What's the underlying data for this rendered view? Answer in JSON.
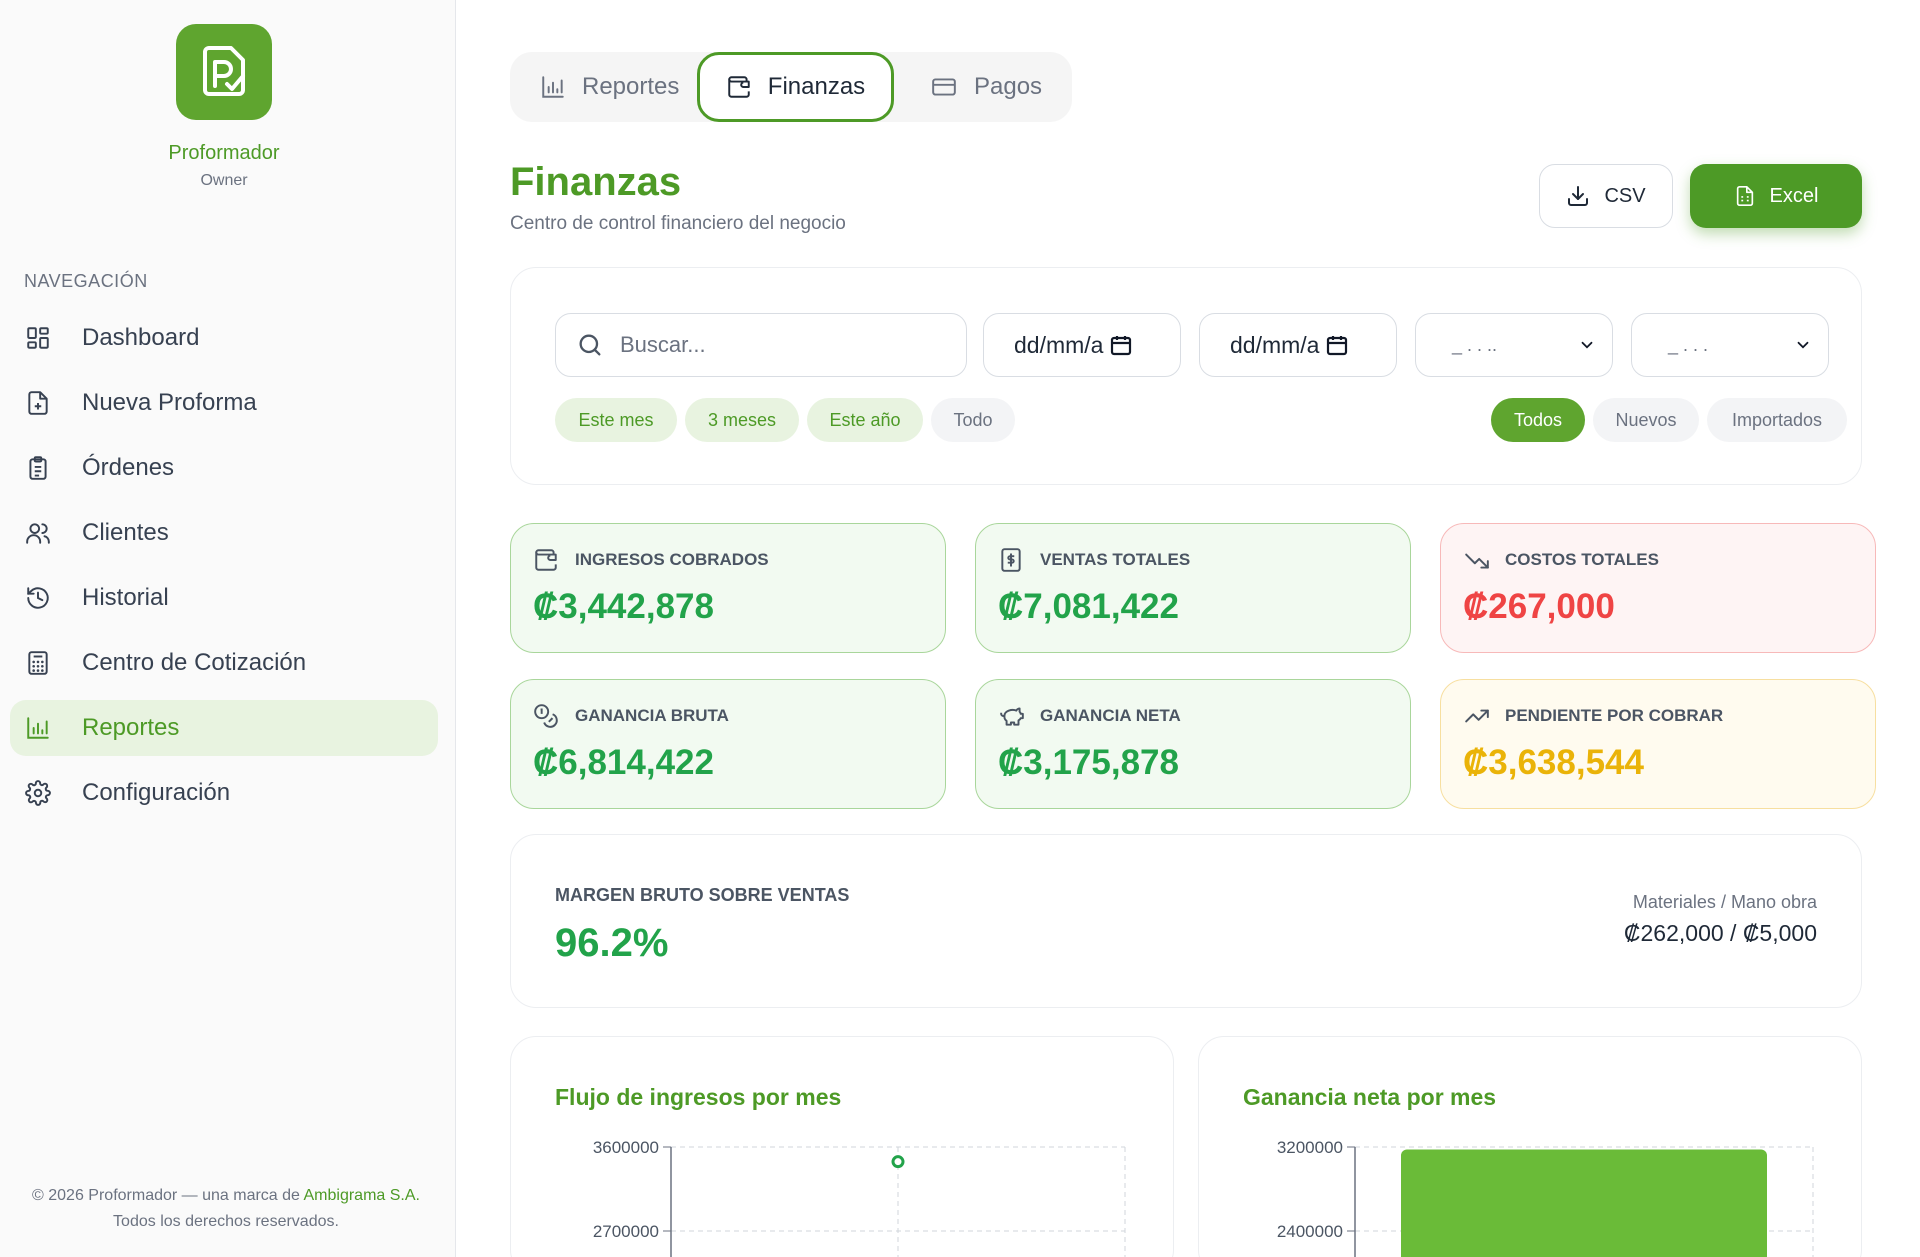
{
  "sidebar": {
    "brand": "Proformador",
    "role": "Owner",
    "nav_title": "NAVEGACIÓN",
    "items": [
      {
        "label": "Dashboard",
        "icon": "dashboard-icon"
      },
      {
        "label": "Nueva Proforma",
        "icon": "file-plus-icon"
      },
      {
        "label": "Órdenes",
        "icon": "clipboard-icon"
      },
      {
        "label": "Clientes",
        "icon": "users-icon"
      },
      {
        "label": "Historial",
        "icon": "history-icon"
      },
      {
        "label": "Centro de Cotización",
        "icon": "calculator-icon"
      },
      {
        "label": "Reportes",
        "icon": "bar-chart-icon",
        "active": true
      },
      {
        "label": "Configuración",
        "icon": "gear-icon"
      }
    ],
    "footer": {
      "prefix": "© 2026 Proformador — una marca de",
      "link": "Ambigrama S.A.",
      "suffix": "Todos los derechos reservados."
    }
  },
  "tabs": [
    {
      "label": "Reportes",
      "icon": "bar-chart-icon"
    },
    {
      "label": "Finanzas",
      "icon": "wallet-icon",
      "active": true
    },
    {
      "label": "Pagos",
      "icon": "credit-card-icon"
    }
  ],
  "header": {
    "title": "Finanzas",
    "subtitle": "Centro de control financiero del negocio",
    "csv_label": "CSV",
    "excel_label": "Excel"
  },
  "filters": {
    "search_placeholder": "Buscar...",
    "date_from": "dd/mm/a",
    "date_to": "dd/mm/a",
    "select1": "_ . . ..",
    "select2": "_ . . .",
    "period_chips": [
      "Este mes",
      "3 meses",
      "Este año",
      "Todo"
    ],
    "type_chips": [
      "Todos",
      "Nuevos",
      "Importados"
    ],
    "active_type": "Todos"
  },
  "kpis": [
    {
      "label": "INGRESOS COBRADOS",
      "value": "₡3,442,878",
      "icon": "wallet-icon",
      "tone": "green"
    },
    {
      "label": "VENTAS TOTALES",
      "value": "₡7,081,422",
      "icon": "dollar-receipt-icon",
      "tone": "green"
    },
    {
      "label": "COSTOS TOTALES",
      "value": "₡267,000",
      "icon": "trending-down-icon",
      "tone": "red"
    },
    {
      "label": "GANANCIA BRUTA",
      "value": "₡6,814,422",
      "icon": "coins-icon",
      "tone": "green"
    },
    {
      "label": "GANANCIA NETA",
      "value": "₡3,175,878",
      "icon": "piggy-bank-icon",
      "tone": "green"
    },
    {
      "label": "PENDIENTE POR COBRAR",
      "value": "₡3,638,544",
      "icon": "trending-up-icon",
      "tone": "yellow"
    }
  ],
  "margin": {
    "label": "MARGEN BRUTO SOBRE VENTAS",
    "value": "96.2%",
    "mat_label": "Materiales / Mano obra",
    "mat_value": "₡262,000 / ₡5,000"
  },
  "colors": {
    "primary": "#4d9a26",
    "accent": "#6abb38",
    "positive": "#22a34a",
    "negative": "#ef4444",
    "warning": "#eab308"
  },
  "chart_data": [
    {
      "type": "line",
      "title": "Flujo de ingresos por mes",
      "yticks": [
        "3600000",
        "2700000"
      ],
      "ylim": [
        2700000,
        3600000
      ],
      "series": [
        {
          "values": [
            3442878
          ]
        }
      ],
      "grid": true
    },
    {
      "type": "bar",
      "title": "Ganancia neta por mes",
      "yticks": [
        "3200000",
        "2400000"
      ],
      "ylim": [
        2400000,
        3200000
      ],
      "series": [
        {
          "values": [
            3175878
          ]
        }
      ],
      "grid": true
    }
  ]
}
